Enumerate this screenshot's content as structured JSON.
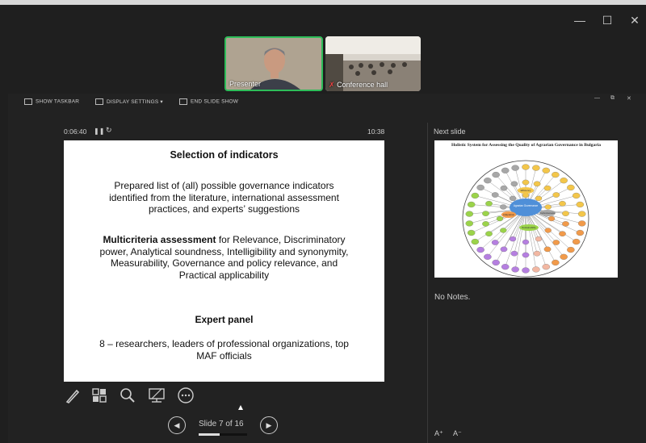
{
  "window": {
    "minimize_glyph": "—",
    "maximize_glyph": "☐",
    "close_glyph": "✕"
  },
  "video_tiles": [
    {
      "label": "Presenter"
    },
    {
      "label": "Conference hall"
    }
  ],
  "toolbar": {
    "show_taskbar": "SHOW TASKBAR",
    "display_settings": "DISPLAY SETTINGS ▾",
    "end_slide_show": "END SLIDE SHOW"
  },
  "timer": {
    "elapsed": "0:06:40",
    "pause_glyph": "❚❚",
    "reset_glyph": "↻",
    "clock": "10:38"
  },
  "slide": {
    "heading": "Selection of indicators",
    "para1": [
      "Prepared list of (all) possible governance indicators",
      "identified from the literature, international assessment",
      "practices, and experts’ suggestions"
    ],
    "multicriteria_bold": "Multicriteria assessment",
    "multicriteria_rest_first": " for Relevance, Discriminatory",
    "multicriteria_lines": [
      "power, Analytical soundness, Intelligibility and synonymity,",
      "Measurability, Governance and policy relevance, and",
      "Practical applicability"
    ],
    "expert_heading": "Expert panel",
    "expert_lines": [
      "8 – researchers, leaders of professional organizations, top",
      "MAF officials"
    ]
  },
  "next_slide": {
    "label": "Next slide",
    "title": "Holistic System for Assessing the Quality of Agrarian Governance in Bulgaria",
    "center_labels": [
      "Agrarian Governance",
      "Efficiency",
      "Adaptation",
      "Sustainability",
      "Inclusiveness"
    ],
    "colors": {
      "yellow": "#f3c64a",
      "orange": "#f19a4a",
      "gray": "#a7a7a7",
      "green": "#9bd34a",
      "purple": "#b57fe0",
      "pink": "#f2b7a2",
      "blue": "#4f8fd8"
    }
  },
  "notes": {
    "text": "No Notes."
  },
  "navigation": {
    "prev_glyph": "◀",
    "next_glyph": "▶",
    "counter": "Slide 7 of 16",
    "progress": 0.4375
  },
  "tools": [
    "pen-icon",
    "slides-grid-icon",
    "zoom-icon",
    "subtitles-icon",
    "more-options-icon"
  ],
  "font_controls": {
    "increase": "A⁺",
    "decrease": "A⁻"
  }
}
